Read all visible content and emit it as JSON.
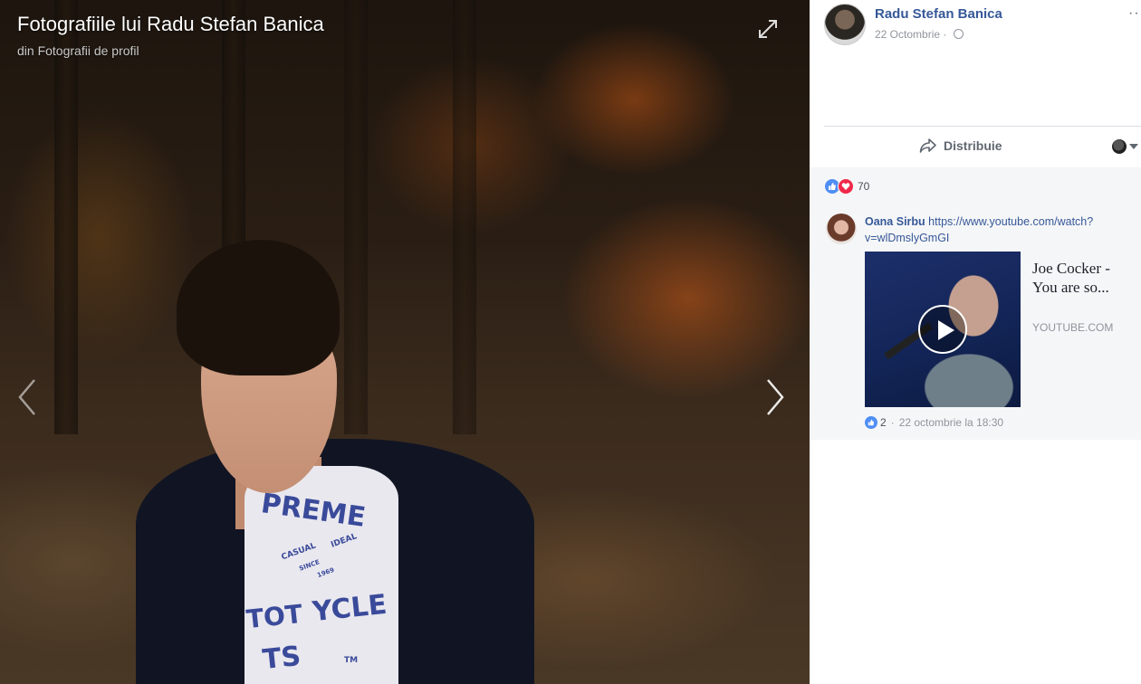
{
  "viewer": {
    "title": "Fotografiile lui Radu Stefan Banica",
    "subtitle": "din Fotografii de profil",
    "shirt_text": [
      "PREME",
      "CASUAL",
      "IDEAL",
      "SINCE",
      "1969",
      "TOT",
      "YCLE",
      "TS",
      "TM"
    ]
  },
  "post": {
    "author": "Radu Stefan Banica",
    "date": "22 Octombrie",
    "separator": "·",
    "more": "···",
    "share_label": "Distribuie"
  },
  "reactions": {
    "count": "70",
    "colors": {
      "like": "#4f8ef5",
      "love": "#f0284a"
    }
  },
  "comment": {
    "author": "Oana Sirbu",
    "link": "https://www.youtube.com/watch?v=wlDmslyGmGI",
    "video_title": "Joe Cocker - You are so...",
    "source": "YOUTUBE.COM",
    "likes": "2",
    "timestamp": "22 octombrie la 18:30",
    "separator": "·"
  }
}
